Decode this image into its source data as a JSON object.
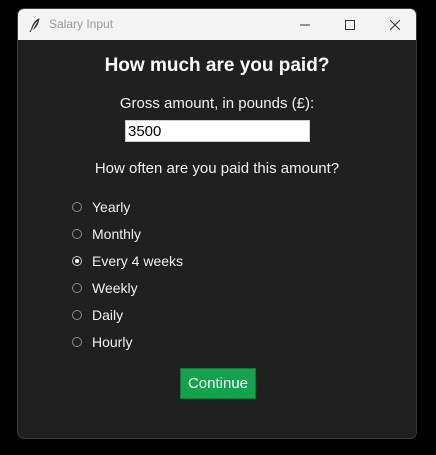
{
  "window": {
    "title": "Salary Input",
    "app_icon": "feather-icon"
  },
  "titlebar_controls": {
    "minimize_icon": "minimize-icon",
    "maximize_icon": "maximize-icon",
    "close_icon": "close-icon"
  },
  "form": {
    "heading": "How much are you paid?",
    "gross_label": "Gross amount, in pounds (£):",
    "gross_value": "3500",
    "frequency_label": "How often are you paid this amount?",
    "frequency_options": [
      {
        "label": "Yearly",
        "selected": false
      },
      {
        "label": "Monthly",
        "selected": false
      },
      {
        "label": "Every 4 weeks",
        "selected": true
      },
      {
        "label": "Weekly",
        "selected": false
      },
      {
        "label": "Daily",
        "selected": false
      },
      {
        "label": "Hourly",
        "selected": false
      }
    ],
    "continue_label": "Continue"
  },
  "colors": {
    "background": "#202020",
    "titlebar": "#f3f3f3",
    "continue_button": "#13a34d"
  }
}
